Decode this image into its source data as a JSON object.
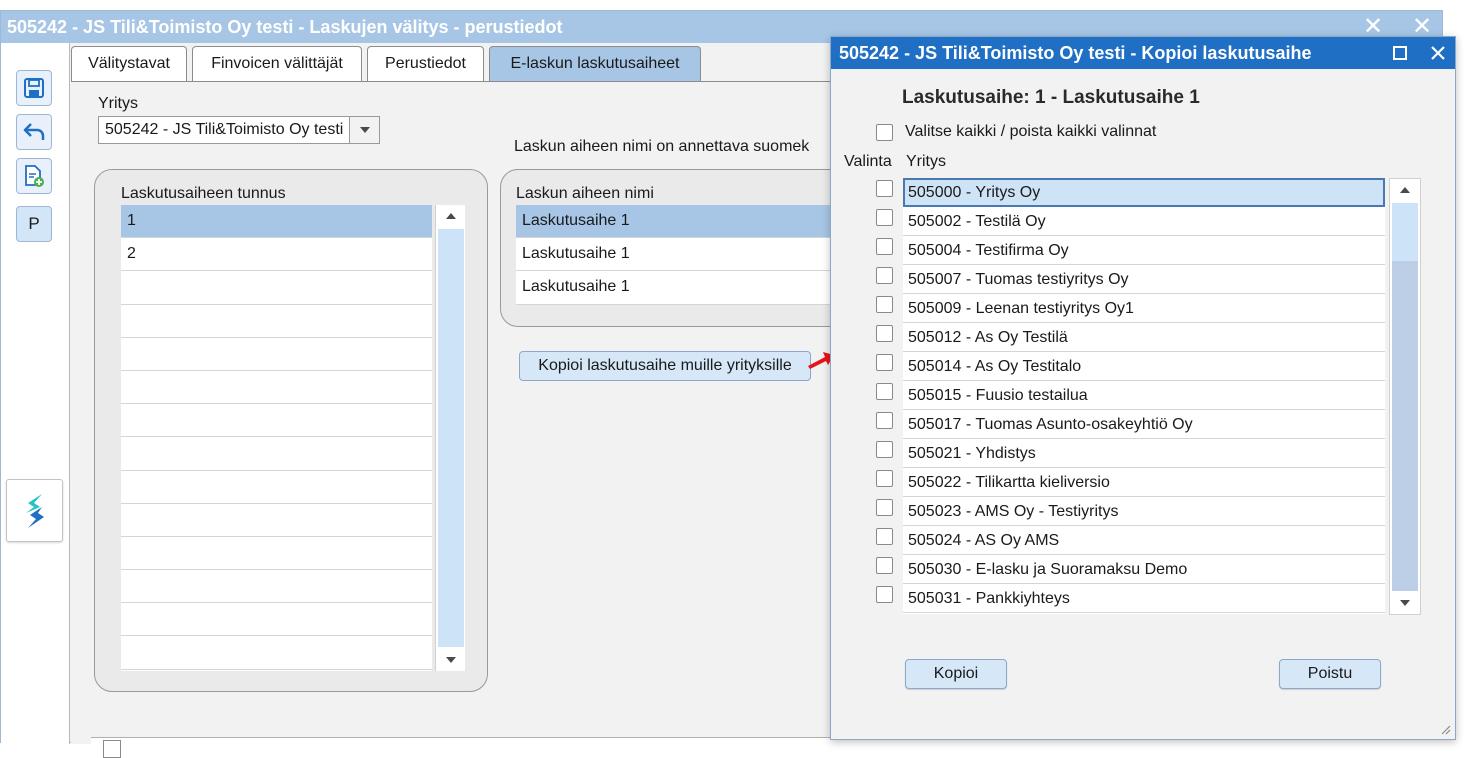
{
  "main": {
    "title": "505242 - JS Tili&Toimisto Oy testi - Laskujen välitys - perustiedot",
    "close_icon": "close-icon",
    "toolbar": {
      "p_label": "P"
    },
    "tabs": [
      "Välitystavat",
      "Finvoicen välittäjät",
      "Perustiedot",
      "E-laskun laskutusaiheet"
    ],
    "active_tab": "E-laskun laskutusaiheet",
    "company_label": "Yritys",
    "company_value": "505242 - JS Tili&Toimisto Oy testi",
    "info_text": "Laskun aiheen nimi on annettava suomek",
    "id_list": {
      "header": "Laskutusaiheen tunnus",
      "rows": [
        "1",
        "2"
      ]
    },
    "name_list": {
      "header": "Laskun aiheen nimi",
      "rows": [
        "Laskutusaihe 1",
        "Laskutusaihe 1",
        "Laskutusaihe 1"
      ]
    },
    "copy_button": "Kopioi laskutusaihe muille yrityksille"
  },
  "dialog": {
    "title": "505242 - JS Tili&Toimisto Oy testi - Kopioi laskutusaihe",
    "heading": "Laskutusaihe: 1 - Laskutusaihe 1",
    "select_all_label": "Valitse kaikki / poista kaikki valinnat",
    "col_select": "Valinta",
    "col_company": "Yritys",
    "companies": [
      "505000 - Yritys Oy",
      "505002 - Testilä Oy",
      "505004 - Testifirma Oy",
      "505007 - Tuomas testiyritys Oy",
      "505009 - Leenan testiyritys Oy1",
      "505012 - As Oy Testilä",
      "505014 - As Oy Testitalo",
      "505015 - Fuusio testailua",
      "505017 - Tuomas Asunto-osakeyhtiö Oy",
      "505021 - Yhdistys",
      "505022 - Tilikartta kieliversio",
      "505023 - AMS Oy - Testiyritys",
      "505024 - AS Oy AMS",
      "505030 - E-lasku ja Suoramaksu Demo",
      "505031 - Pankkiyhteys"
    ],
    "copy_button": "Kopioi",
    "exit_button": "Poistu"
  },
  "colors": {
    "accent": "#1f6fc4",
    "selection": "#a7c6e6",
    "annotation_arrow": "#e8141b"
  }
}
